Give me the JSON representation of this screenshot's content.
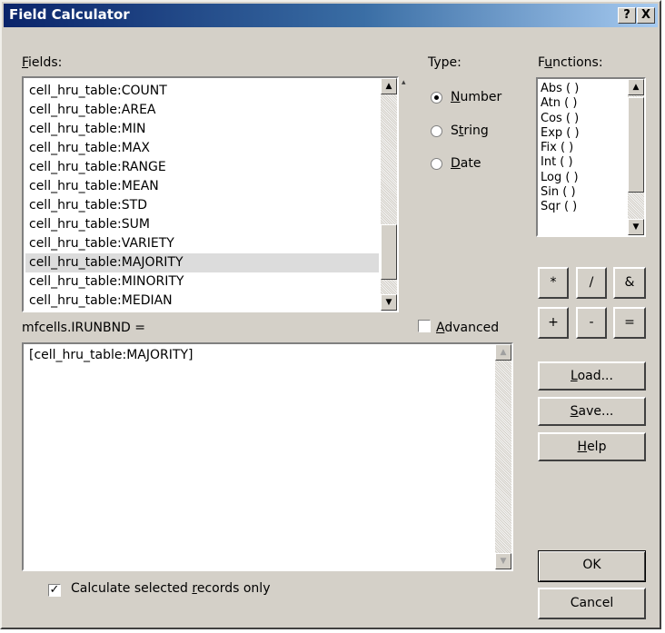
{
  "window": {
    "title": "Field Calculator",
    "help_label": "?",
    "close_label": "X"
  },
  "fields": {
    "label": "Fields:",
    "items": [
      "cell_hru_table:COUNT",
      "cell_hru_table:AREA",
      "cell_hru_table:MIN",
      "cell_hru_table:MAX",
      "cell_hru_table:RANGE",
      "cell_hru_table:MEAN",
      "cell_hru_table:STD",
      "cell_hru_table:SUM",
      "cell_hru_table:VARIETY",
      "cell_hru_table:MAJORITY",
      "cell_hru_table:MINORITY",
      "cell_hru_table:MEDIAN"
    ],
    "selected_index": 9
  },
  "type": {
    "label": "Type:",
    "options": [
      "Number",
      "String",
      "Date"
    ],
    "selected": "Number"
  },
  "functions": {
    "label": "Functions:",
    "items": [
      "Abs ( )",
      "Atn ( )",
      "Cos ( )",
      "Exp ( )",
      "Fix ( )",
      "Int ( )",
      "Log ( )",
      "Sin ( )",
      "Sqr ( )"
    ]
  },
  "operators": {
    "multiply": "*",
    "divide": "/",
    "ampersand": "&",
    "plus": "+",
    "minus": "-",
    "equals": "="
  },
  "expression": {
    "target_label": "mfcells.IRUNBND =",
    "advanced_label": "Advanced",
    "advanced_checked": false,
    "value": "[cell_hru_table:MAJORITY]"
  },
  "buttons": {
    "load": "Load...",
    "save": "Save...",
    "help": "Help",
    "ok": "OK",
    "cancel": "Cancel"
  },
  "selected_only": {
    "label": "Calculate selected records only",
    "checked": true
  }
}
